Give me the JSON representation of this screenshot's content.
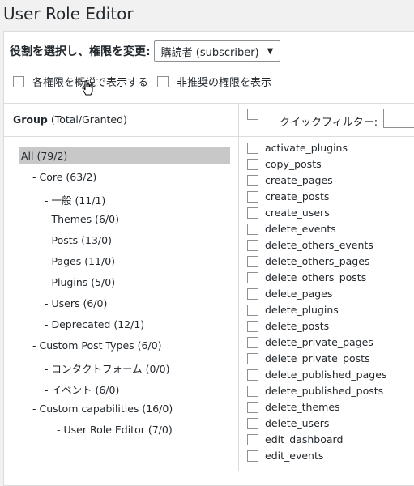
{
  "page": {
    "title": "User Role Editor"
  },
  "role": {
    "label": "役割を選択し、権限を変更:",
    "selected": "購読者 (subscriber)"
  },
  "options": {
    "show_human_readable": "各権限を概説で表示する",
    "show_deprecated": "非推奨の権限を表示"
  },
  "group": {
    "header_bold": "Group",
    "header_rest": " (Total/Granted)"
  },
  "quick_filter": {
    "label": "クイックフィルター:"
  },
  "tree": [
    {
      "label": "All (79/2)",
      "indent": 0,
      "selected": true
    },
    {
      "label": "- Core (63/2)",
      "indent": 1
    },
    {
      "label": "- 一般 (11/1)",
      "indent": 2
    },
    {
      "label": "- Themes (6/0)",
      "indent": 2
    },
    {
      "label": "- Posts (13/0)",
      "indent": 2
    },
    {
      "label": "- Pages (11/0)",
      "indent": 2
    },
    {
      "label": "- Plugins (5/0)",
      "indent": 2
    },
    {
      "label": "- Users (6/0)",
      "indent": 2
    },
    {
      "label": "- Deprecated (12/1)",
      "indent": 2
    },
    {
      "label": "- Custom Post Types (6/0)",
      "indent": 1
    },
    {
      "label": "- コンタクトフォーム (0/0)",
      "indent": 2
    },
    {
      "label": "- イベント (6/0)",
      "indent": 2
    },
    {
      "label": "- Custom capabilities (16/0)",
      "indent": 1
    },
    {
      "label": "- User Role Editor (7/0)",
      "indent": 3
    }
  ],
  "capabilities": [
    "activate_plugins",
    "copy_posts",
    "create_pages",
    "create_posts",
    "create_users",
    "delete_events",
    "delete_others_events",
    "delete_others_pages",
    "delete_others_posts",
    "delete_pages",
    "delete_plugins",
    "delete_posts",
    "delete_private_pages",
    "delete_private_posts",
    "delete_published_pages",
    "delete_published_posts",
    "delete_themes",
    "delete_users",
    "edit_dashboard",
    "edit_events"
  ]
}
